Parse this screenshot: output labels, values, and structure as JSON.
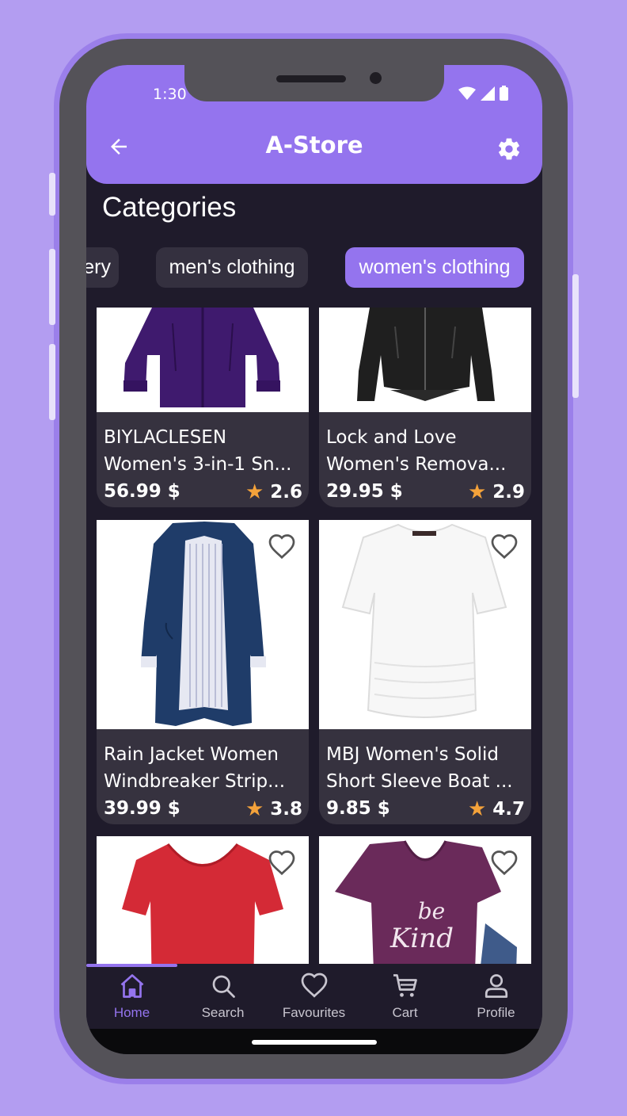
{
  "status_bar": {
    "time": "1:30"
  },
  "app_bar": {
    "title": "A-Store"
  },
  "categories": {
    "title": "Categories",
    "chips": [
      {
        "label": "ery",
        "active": false
      },
      {
        "label": "men's clothing",
        "active": false
      },
      {
        "label": "women's clothing",
        "active": true
      }
    ]
  },
  "products": [
    {
      "name_line1": "BIYLACLESEN",
      "name_line2": "Women's 3-in-1 Sn...",
      "price": "56.99 $",
      "rating": "2.6",
      "image": "purple-jacket"
    },
    {
      "name_line1": "Lock and Love",
      "name_line2": "Women's Remova...",
      "price": "29.95 $",
      "rating": "2.9",
      "image": "black-leather-jacket"
    },
    {
      "name_line1": "Rain Jacket Women",
      "name_line2": "Windbreaker Strip...",
      "price": "39.99 $",
      "rating": "3.8",
      "image": "navy-rain-jacket"
    },
    {
      "name_line1": "MBJ Women's Solid",
      "name_line2": "Short Sleeve Boat ...",
      "price": "9.85 $",
      "rating": "4.7",
      "image": "white-top"
    },
    {
      "name_line1": "",
      "name_line2": "",
      "price": "",
      "rating": "",
      "image": "red-tshirt"
    },
    {
      "name_line1": "",
      "name_line2": "",
      "price": "",
      "rating": "",
      "image": "purple-be-kind-tshirt",
      "image_text_line1": "be",
      "image_text_line2": "Kind"
    }
  ],
  "bottom_nav": {
    "items": [
      {
        "label": "Home",
        "icon": "home-icon",
        "active": true
      },
      {
        "label": "Search",
        "icon": "search-icon",
        "active": false
      },
      {
        "label": "Favourites",
        "icon": "heart-icon",
        "active": false
      },
      {
        "label": "Cart",
        "icon": "cart-icon",
        "active": false
      },
      {
        "label": "Profile",
        "icon": "profile-icon",
        "active": false
      }
    ]
  },
  "colors": {
    "accent": "#9474ee",
    "background": "#1f1b2b",
    "card": "#36323f",
    "star": "#f4a23a",
    "page_bg": "#b39df1"
  }
}
